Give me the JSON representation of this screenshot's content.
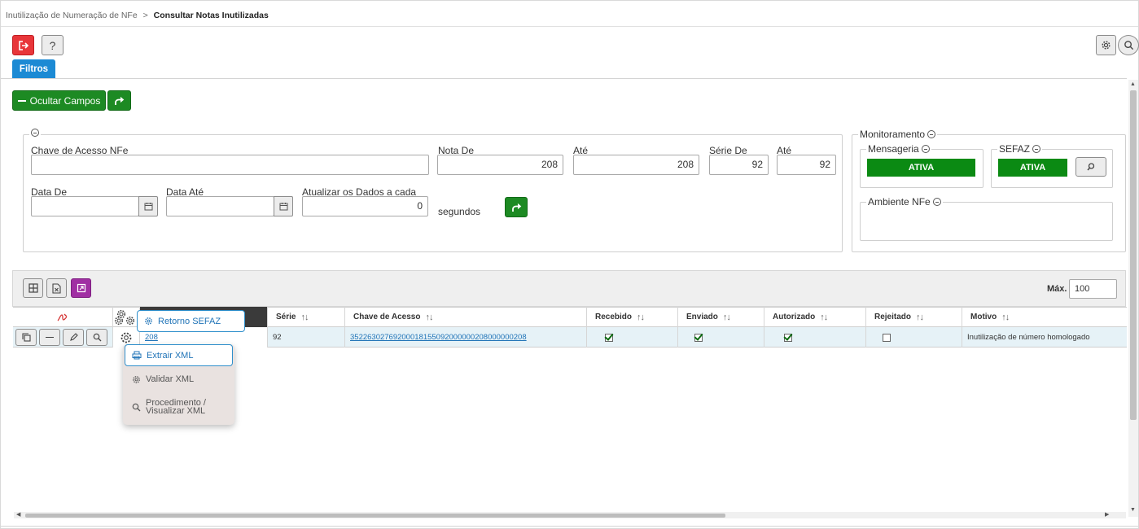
{
  "breadcrumb": {
    "parent": "Inutilização de Numeração de NFe",
    "separator": ">",
    "current": "Consultar Notas Inutilizadas"
  },
  "toolbar": {
    "help_label": "?",
    "filtros_label": "Filtros",
    "ocultar_label": "Ocultar Campos"
  },
  "filters": {
    "chave_label": "Chave de Acesso NFe",
    "chave_value": "",
    "nota_de_label": "Nota De",
    "nota_de_value": "208",
    "ate1_label": "Até",
    "ate1_value": "208",
    "serie_de_label": "Série De",
    "serie_de_value": "92",
    "ate2_label": "Até",
    "ate2_value": "92",
    "data_de_label": "Data De",
    "data_de_value": "",
    "data_ate_label": "Data Até",
    "data_ate_value": "",
    "atualizar_label": "Atualizar os Dados a cada",
    "atualizar_value": "0",
    "segundos_label": "segundos"
  },
  "monitor": {
    "title": "Monitoramento",
    "mensageria_label": "Mensageria",
    "mensageria_status": "ATIVA",
    "sefaz_label": "SEFAZ",
    "sefaz_status": "ATIVA",
    "ambiente_label": "Ambiente NFe",
    "status_color": "#0b8a13"
  },
  "grid": {
    "max_label": "Máx.",
    "max_value": "100",
    "columns": [
      "Série",
      "Chave de Acesso",
      "Recebido",
      "Enviado",
      "Autorizado",
      "Rejeitado",
      "Motivo"
    ],
    "row": {
      "nota": "208",
      "serie": "92",
      "chave": "35226302769200018155092000000208000000208",
      "recebido": true,
      "enviado": true,
      "autorizado": true,
      "rejeitado": false,
      "motivo": "Inutilização de número homologado"
    }
  },
  "context_menu": {
    "retorno": "Retorno SEFAZ",
    "extrair": "Extrair XML",
    "validar": "Validar XML",
    "procedimento_1": "Procedimento /",
    "procedimento_2": "Visualizar XML"
  }
}
